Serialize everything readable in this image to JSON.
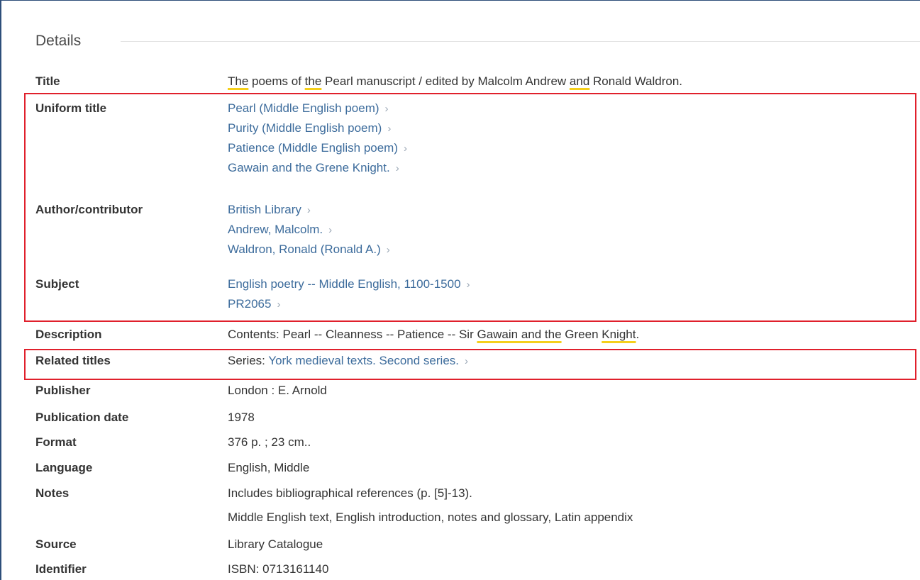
{
  "section": {
    "title": "Details"
  },
  "rows": {
    "title": {
      "label": "Title",
      "parts": [
        "The",
        " poems of ",
        "the",
        " Pearl manuscript / edited by Malcolm Andrew ",
        "and",
        " Ronald Waldron."
      ]
    },
    "uniform_title": {
      "label": "Uniform title",
      "links": [
        "Pearl (Middle English poem)",
        "Purity (Middle English poem)",
        "Patience (Middle English poem)",
        "Gawain and the Grene Knight."
      ]
    },
    "author": {
      "label": "Author/contributor",
      "links": [
        "British Library",
        "Andrew, Malcolm.",
        "Waldron, Ronald (Ronald A.)"
      ]
    },
    "subject": {
      "label": "Subject",
      "links": [
        "English poetry -- Middle English, 1100-1500",
        "PR2065"
      ]
    },
    "description": {
      "label": "Description",
      "parts": [
        "Contents: Pearl -- Cleanness -- Patience -- Sir ",
        "Gawain and the",
        " Green ",
        "Knight",
        "."
      ]
    },
    "related_titles": {
      "label": "Related titles",
      "prefix": "Series: ",
      "link": "York medieval texts. Second series."
    },
    "publisher": {
      "label": "Publisher",
      "value": "London : E. Arnold"
    },
    "publication_date": {
      "label": "Publication date",
      "value": "1978"
    },
    "format": {
      "label": "Format",
      "value": "376 p. ; 23 cm.."
    },
    "language": {
      "label": "Language",
      "value": "English, Middle"
    },
    "notes": {
      "label": "Notes",
      "values": [
        "Includes bibliographical references (p. [5]-13).",
        "Middle English text, English introduction, notes and glossary, Latin appendix"
      ]
    },
    "source": {
      "label": "Source",
      "value": "Library Catalogue"
    },
    "identifier": {
      "label": "Identifier",
      "value": "ISBN: 0713161140"
    }
  },
  "icons": {
    "link_chevron": "chevron-right-icon"
  },
  "colors": {
    "link": "#3d6c9c",
    "highlight_box": "#e0202c",
    "underline_mark": "#f5cf1b"
  }
}
